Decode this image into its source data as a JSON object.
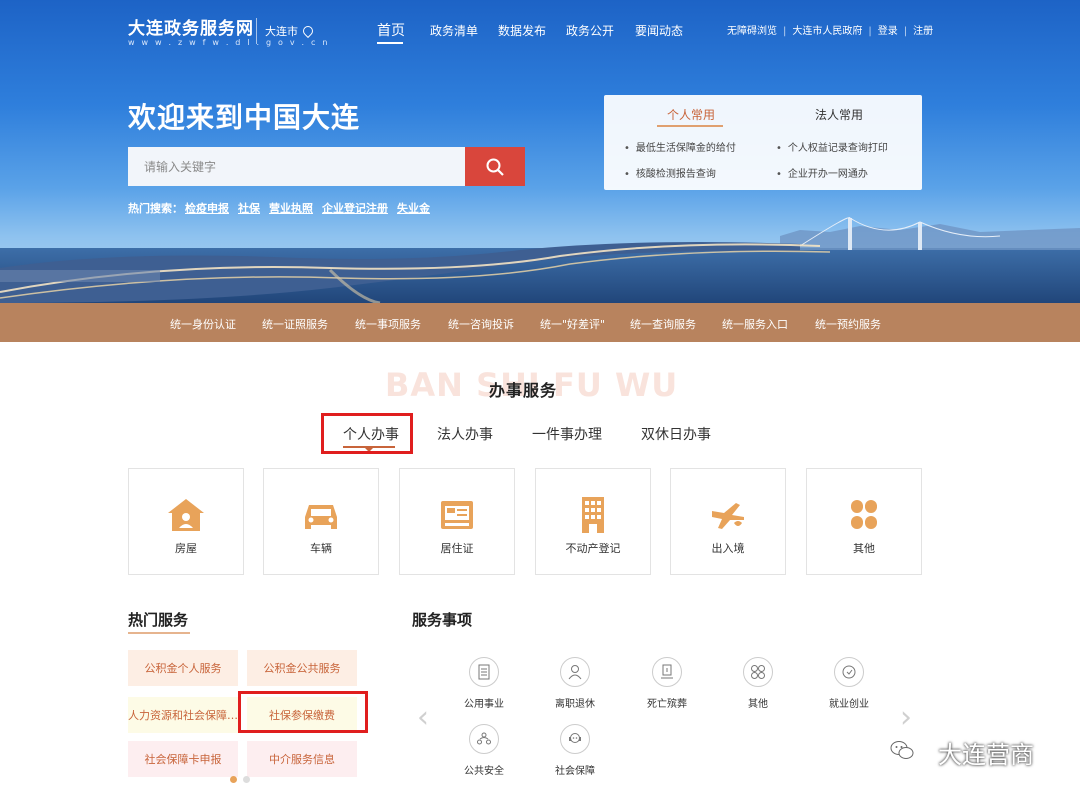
{
  "header": {
    "site_title": "大连政务服务网",
    "site_url": "w w w . z w f w . d l . g o v . c n",
    "city": "大连市",
    "nav": [
      "首页",
      "政务清单",
      "数据发布",
      "政务公开",
      "要闻动态"
    ],
    "top_links": [
      "无障碍浏览",
      "大连市人民政府",
      "登录",
      "注册"
    ],
    "top_sep": "|"
  },
  "hero": {
    "welcome": "欢迎来到中国大连",
    "search_placeholder": "请输入关键字",
    "hot_label": "热门搜索：",
    "hot_terms": [
      "检疫申报",
      "社保",
      "营业执照",
      "企业登记注册",
      "失业金"
    ]
  },
  "common_panel": {
    "tabs": [
      "个人常用",
      "法人常用"
    ],
    "items": [
      "最低生活保障金的给付",
      "个人权益记录查询打印",
      "核酸检测报告查询",
      "企业开办一网通办"
    ]
  },
  "unified_bar": [
    "统一身份认证",
    "统一证照服务",
    "统一事项服务",
    "统一咨询投诉",
    "统一\"好差评\"",
    "统一查询服务",
    "统一服务入口",
    "统一预约服务"
  ],
  "service": {
    "bg_word": "BAN SHI FU WU",
    "title": "办事服务",
    "tabs": [
      "个人办事",
      "法人办事",
      "一件事办理",
      "双休日办事"
    ],
    "cards": [
      "房屋",
      "车辆",
      "居住证",
      "不动产登记",
      "出入境",
      "其他"
    ]
  },
  "hot_services": {
    "title": "热门服务",
    "items": [
      "公积金个人服务",
      "公积金公共服务",
      "人力资源和社会保障…",
      "社保参保缴费",
      "社会保障卡申报",
      "中介服务信息"
    ]
  },
  "service_items": {
    "title": "服务事项",
    "items": [
      "公用事业",
      "离职退休",
      "死亡殡葬",
      "其他",
      "就业创业",
      "公共安全",
      "社会保障"
    ],
    "prev": "‹",
    "next": "›"
  },
  "watermark": "大连营商",
  "colors": {
    "accent": "#c8643a",
    "bar": "#b8835e",
    "search_btn": "#d9463c",
    "highlight": "#e01e1e"
  }
}
